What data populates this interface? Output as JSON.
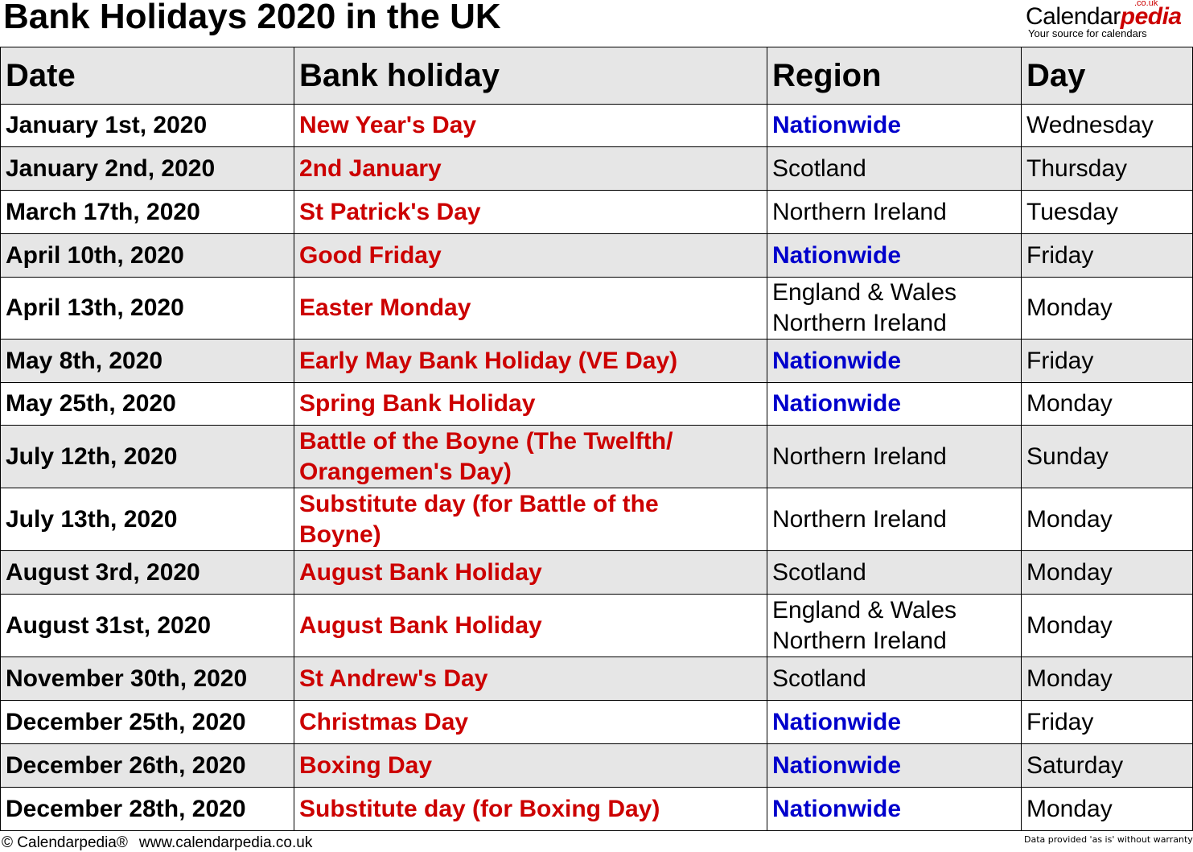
{
  "title": "Bank Holidays 2020 in the UK",
  "logo": {
    "brand_main": "Calendar",
    "brand_accent": "pedia",
    "domain_suffix": ".co.uk",
    "tagline": "Your source for calendars"
  },
  "colors": {
    "holiday_text": "#cc0000",
    "nationwide_text": "#0000cc",
    "header_bg": "#e6e6e6",
    "shaded_row_bg": "#e6e6e6"
  },
  "table": {
    "headers": [
      "Date",
      "Bank holiday",
      "Region",
      "Day"
    ],
    "rows": [
      {
        "date": "January 1st, 2020",
        "holiday": "New Year's Day",
        "region": "Nationwide",
        "day": "Wednesday"
      },
      {
        "date": "January 2nd, 2020",
        "holiday": "2nd January",
        "region": "Scotland",
        "day": "Thursday"
      },
      {
        "date": "March 17th, 2020",
        "holiday": "St Patrick's Day",
        "region": "Northern Ireland",
        "day": "Tuesday"
      },
      {
        "date": "April 10th, 2020",
        "holiday": "Good Friday",
        "region": "Nationwide",
        "day": "Friday"
      },
      {
        "date": "April 13th, 2020",
        "holiday": "Easter Monday",
        "region": "England & Wales",
        "region2": "Northern Ireland",
        "day": "Monday"
      },
      {
        "date": "May 8th, 2020",
        "holiday": "Early May Bank Holiday (VE Day)",
        "region": "Nationwide",
        "day": "Friday"
      },
      {
        "date": "May 25th, 2020",
        "holiday": "Spring Bank Holiday",
        "region": "Nationwide",
        "day": "Monday"
      },
      {
        "date": "July 12th, 2020",
        "holiday": "Battle of the Boyne (The Twelfth/",
        "holiday2": "Orangemen's Day)",
        "region": "Northern Ireland",
        "day": "Sunday"
      },
      {
        "date": "July 13th, 2020",
        "holiday": "Substitute day (for Battle of the",
        "holiday2": "Boyne)",
        "region": "Northern Ireland",
        "day": "Monday"
      },
      {
        "date": "August 3rd, 2020",
        "holiday": "August Bank Holiday",
        "region": "Scotland",
        "day": "Monday"
      },
      {
        "date": "August 31st, 2020",
        "holiday": "August Bank Holiday",
        "region": "England & Wales",
        "region2": "Northern Ireland",
        "day": "Monday"
      },
      {
        "date": "November 30th, 2020",
        "holiday": "St Andrew's Day",
        "region": "Scotland",
        "day": "Monday"
      },
      {
        "date": "December 25th, 2020",
        "holiday": "Christmas Day",
        "region": "Nationwide",
        "day": "Friday"
      },
      {
        "date": "December 26th, 2020",
        "holiday": "Boxing Day",
        "region": "Nationwide",
        "day": "Saturday"
      },
      {
        "date": "December 28th, 2020",
        "holiday": "Substitute day (for Boxing Day)",
        "region": "Nationwide",
        "day": "Monday"
      }
    ]
  },
  "footer": {
    "copyright": "© Calendarpedia®",
    "url": "www.calendarpedia.co.uk",
    "disclaimer": "Data provided 'as is' without warranty"
  }
}
